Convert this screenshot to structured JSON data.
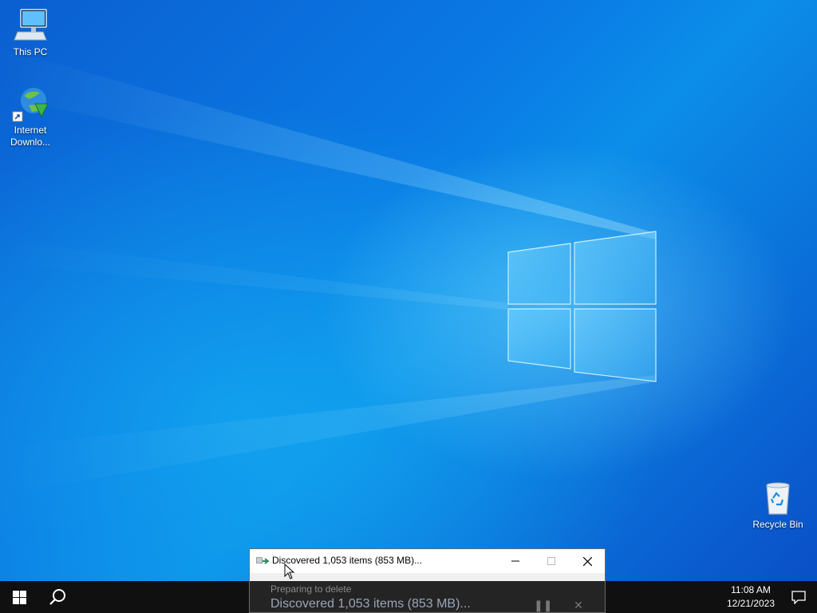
{
  "desktop": {
    "icons": [
      {
        "label": "This PC",
        "icon": "computer-icon"
      },
      {
        "label": "Internet\nDownlo...",
        "icon": "internet-download-manager-icon"
      },
      {
        "label": "Recycle Bin",
        "icon": "recycle-bin-icon"
      }
    ]
  },
  "dialog": {
    "title": "Discovered 1,053 items (853 MB)...",
    "subtitle": "Preparing to delete",
    "status": "Discovered 1,053 items (853 MB)..."
  },
  "taskbar": {
    "time": "11:08 AM",
    "date": "12/21/2023"
  },
  "colors": {
    "taskbar_bg": "#101010",
    "desktop_accent": "#0a78e4"
  }
}
